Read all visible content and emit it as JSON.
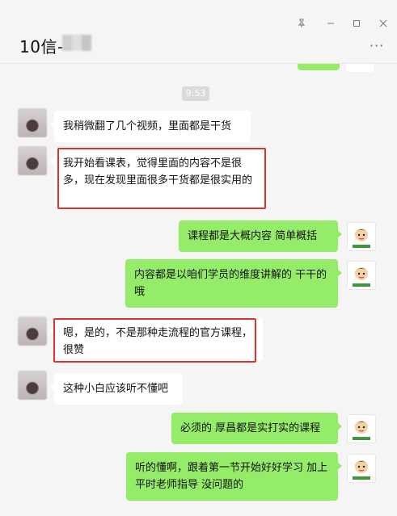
{
  "header": {
    "title": "10信-",
    "more_label": "···",
    "window_controls": [
      "pin-icon",
      "minimize-icon",
      "maximize-icon",
      "close-icon"
    ]
  },
  "chat": {
    "timestamp": "9:53",
    "messages": [
      {
        "side": "in",
        "text": "我稍微翻了几个视频，里面都是干货",
        "highlighted": false
      },
      {
        "side": "in",
        "text": "我开始看课表，觉得里面的内容不是很多，现在发现里面很多干货都是很实用的",
        "highlighted": true
      },
      {
        "side": "out",
        "text": "课程都是大概内容 简单概括",
        "highlighted": false
      },
      {
        "side": "out",
        "text": "内容都是以咱们学员的维度讲解的 干干的哦",
        "highlighted": false
      },
      {
        "side": "in",
        "text": "嗯，是的，不是那种走流程的官方课程，很赞",
        "highlighted": true
      },
      {
        "side": "in",
        "text": "这种小白应该听不懂吧",
        "highlighted": false
      },
      {
        "side": "out",
        "text": "必须的 厚昌都是实打实的课程",
        "highlighted": false
      },
      {
        "side": "out",
        "text": "听的懂啊，跟着第一节开始好好学习 加上平时老师指导 没问题的",
        "highlighted": false
      }
    ]
  },
  "colors": {
    "outgoing_bubble": "#95ec69",
    "incoming_bubble": "#ffffff",
    "highlight_box": "#e0322a",
    "background": "#f5f5f5"
  }
}
